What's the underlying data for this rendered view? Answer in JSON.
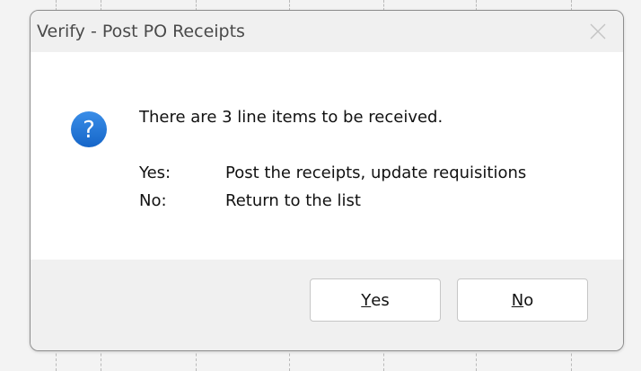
{
  "dialog": {
    "title": "Verify - Post PO Receipts",
    "close_icon": "close-icon",
    "message_icon": "question-icon",
    "message": "There are 3 line items to be received.",
    "options": [
      {
        "key": "Yes:",
        "description": "Post the receipts, update requisitions"
      },
      {
        "key": "No:",
        "description": "Return to the list"
      }
    ],
    "buttons": {
      "yes": {
        "mnemonic": "Y",
        "rest": "es"
      },
      "no": {
        "mnemonic": "N",
        "rest": "o"
      }
    }
  },
  "colors": {
    "icon_blue": "#1a73d9",
    "dialog_border": "#8d8d8d",
    "content_bg": "#ffffff",
    "chrome_bg": "#f0f0f0"
  }
}
